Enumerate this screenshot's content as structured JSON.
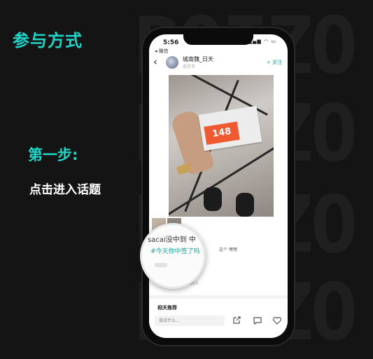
{
  "promo": {
    "headline": "参与方式",
    "step_title": "第一步:",
    "step_desc": "点击进入话题",
    "background_word": "POIZO"
  },
  "phone": {
    "status": {
      "time": "5:56",
      "back_label": "◂ 微信"
    },
    "post": {
      "username": "城南魏_日天",
      "location": "南京市",
      "follow_label": "+ 关注",
      "price_tag": "148",
      "body_text": "这个  嘿嘿",
      "liked_text": "第一个有品位的人"
    },
    "magnifier": {
      "line1": "sacai没中到 中",
      "topic": "#今天你中签了吗"
    },
    "related_label": "相关推荐",
    "comment_placeholder": "说点什么..."
  },
  "colors": {
    "accent": "#20d6c9",
    "topic": "#1aa39a",
    "price_tag": "#ef5a32",
    "background": "#141414"
  },
  "icons": [
    "back-arrow-icon",
    "share-icon",
    "comment-icon",
    "heart-icon",
    "signal-icon",
    "wifi-icon",
    "battery-icon"
  ]
}
